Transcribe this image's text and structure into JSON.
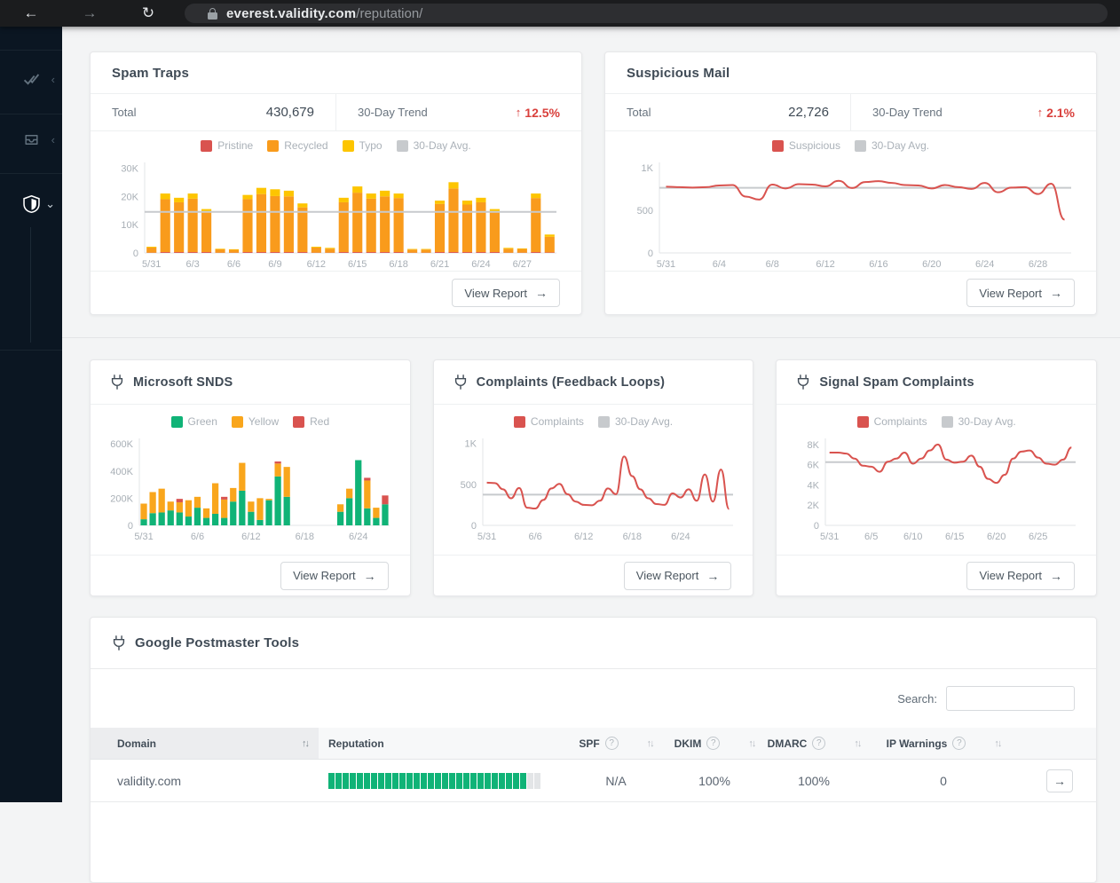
{
  "browser": {
    "url_host": "everest.validity.com",
    "url_path": "/reputation/"
  },
  "icons": {
    "back": "←",
    "forward": "→",
    "refresh": "↻",
    "trend_up": "↑",
    "arrow_right": "→",
    "sort": "↑↓",
    "help": "?",
    "chevron_left": "‹",
    "chevron_down": "⌄"
  },
  "labels": {
    "total": "Total",
    "trend": "30-Day Trend",
    "view_report": "View Report",
    "search": "Search:"
  },
  "sidebar": {
    "items": [
      {
        "name": "verification",
        "icon": "double-check"
      },
      {
        "name": "inbox",
        "icon": "inbox-tray"
      },
      {
        "name": "reputation",
        "icon": "shield",
        "active": true
      }
    ]
  },
  "cards": {
    "spam_traps": {
      "title": "Spam Traps",
      "total": "430,679",
      "trend": "12.5%"
    },
    "suspicious_mail": {
      "title": "Suspicious Mail",
      "total": "22,726",
      "trend": "2.1%"
    },
    "microsoft_snds": {
      "title": "Microsoft SNDS"
    },
    "complaints_fbl": {
      "title": "Complaints (Feedback Loops)"
    },
    "signal_spam": {
      "title": "Signal Spam Complaints"
    },
    "google_postmaster": {
      "title": "Google Postmaster Tools"
    }
  },
  "table": {
    "headers": [
      {
        "label": "Domain",
        "sort": true,
        "help": false
      },
      {
        "label": "Reputation",
        "sort": false,
        "help": false
      },
      {
        "label": "SPF",
        "sort": true,
        "help": true
      },
      {
        "label": "DKIM",
        "sort": true,
        "help": true
      },
      {
        "label": "DMARC",
        "sort": true,
        "help": true
      },
      {
        "label": "IP Warnings",
        "sort": true,
        "help": true
      }
    ],
    "rows": [
      {
        "domain": "validity.com",
        "reputation_segments": 30,
        "reputation_filled": 28,
        "spf": "N/A",
        "dkim": "100%",
        "dmarc": "100%",
        "ip_warnings": "0"
      }
    ]
  },
  "chart_data": [
    {
      "id": "spam-traps",
      "type": "bar",
      "y_unit": "K",
      "ylim": [
        0,
        32
      ],
      "y_ticks": [
        {
          "v": 0,
          "label": "0"
        },
        {
          "v": 10,
          "label": "10K"
        },
        {
          "v": 20,
          "label": "20K"
        },
        {
          "v": 30,
          "label": "30K"
        }
      ],
      "x": [
        "5/31",
        "6/1",
        "6/2",
        "6/3",
        "6/4",
        "6/5",
        "6/6",
        "6/7",
        "6/8",
        "6/9",
        "6/10",
        "6/11",
        "6/12",
        "6/13",
        "6/14",
        "6/15",
        "6/16",
        "6/17",
        "6/18",
        "6/19",
        "6/20",
        "6/21",
        "6/22",
        "6/23",
        "6/24",
        "6/25",
        "6/26",
        "6/27",
        "6/28",
        "6/29"
      ],
      "x_ticks": [
        0,
        3,
        6,
        9,
        12,
        15,
        18,
        21,
        24,
        27
      ],
      "series": [
        {
          "name": "Pristine",
          "color": "#d9534f",
          "values": [
            0.1,
            0.3,
            0.3,
            0.3,
            0.3,
            0.1,
            0.1,
            0.3,
            0.3,
            0.3,
            0.3,
            0.3,
            0.1,
            0.1,
            0.3,
            0.3,
            0.3,
            0.3,
            0.3,
            0.1,
            0.1,
            0.3,
            0.3,
            0.3,
            0.3,
            0.3,
            0.1,
            0.1,
            0.3,
            0.2
          ]
        },
        {
          "name": "Recycled",
          "color": "#f99b1c",
          "values": [
            1.8,
            18.7,
            17.6,
            18.9,
            14.0,
            1.2,
            1.0,
            18.7,
            20.5,
            19.8,
            19.7,
            15.8,
            1.8,
            1.4,
            17.6,
            21.0,
            18.9,
            19.7,
            19.1,
            1.1,
            1.1,
            17.0,
            22.5,
            16.8,
            17.6,
            14.2,
            1.4,
            1.3,
            19.1,
            5.5
          ]
        },
        {
          "name": "Typo",
          "color": "#fdc500",
          "values": [
            0.3,
            2.0,
            1.6,
            1.8,
            1.2,
            0.2,
            0.2,
            1.5,
            2.2,
            2.4,
            2.0,
            1.4,
            0.3,
            0.3,
            1.6,
            2.2,
            1.8,
            2.0,
            1.6,
            0.2,
            0.2,
            1.2,
            2.2,
            1.4,
            1.6,
            1.0,
            0.3,
            0.2,
            1.6,
            0.8
          ]
        }
      ],
      "avg": 14.5,
      "avg_label": "30-Day Avg.",
      "avg_color": "#c7cacd"
    },
    {
      "id": "suspicious-mail",
      "type": "line",
      "ylim": [
        0,
        1060
      ],
      "y_ticks": [
        {
          "v": 0,
          "label": "0"
        },
        {
          "v": 500,
          "label": "500"
        },
        {
          "v": 1000,
          "label": "1K"
        }
      ],
      "x": [
        "5/31",
        "6/1",
        "6/2",
        "6/3",
        "6/4",
        "6/5",
        "6/6",
        "6/7",
        "6/8",
        "6/9",
        "6/10",
        "6/11",
        "6/12",
        "6/13",
        "6/14",
        "6/15",
        "6/16",
        "6/17",
        "6/18",
        "6/19",
        "6/20",
        "6/21",
        "6/22",
        "6/23",
        "6/24",
        "6/25",
        "6/26",
        "6/27",
        "6/28",
        "6/29",
        "6/30"
      ],
      "x_ticks": [
        0,
        4,
        8,
        12,
        16,
        20,
        24,
        28
      ],
      "series": [
        {
          "name": "Suspicious",
          "color": "#d9534f",
          "values": [
            775,
            770,
            765,
            770,
            790,
            795,
            660,
            625,
            800,
            755,
            805,
            800,
            780,
            845,
            760,
            830,
            840,
            820,
            795,
            790,
            755,
            795,
            770,
            750,
            820,
            710,
            765,
            770,
            690,
            810,
            390
          ]
        }
      ],
      "avg": 762,
      "avg_label": "30-Day Avg.",
      "avg_color": "#c7cacd"
    },
    {
      "id": "microsoft-snds",
      "type": "bar",
      "y_unit": "K",
      "ylim": [
        0,
        640
      ],
      "y_ticks": [
        {
          "v": 0,
          "label": "0"
        },
        {
          "v": 200,
          "label": "200K"
        },
        {
          "v": 400,
          "label": "400K"
        },
        {
          "v": 600,
          "label": "600K"
        }
      ],
      "x": [
        "5/31",
        "6/1",
        "6/2",
        "6/3",
        "6/4",
        "6/5",
        "6/6",
        "6/7",
        "6/8",
        "6/9",
        "6/10",
        "6/11",
        "6/12",
        "6/13",
        "6/14",
        "6/15",
        "6/16",
        "6/17",
        "6/18",
        "6/19",
        "6/20",
        "6/21",
        "6/22",
        "6/23",
        "6/24",
        "6/25",
        "6/26",
        "6/27"
      ],
      "x_ticks": [
        0,
        6,
        12,
        18,
        24
      ],
      "series": [
        {
          "name": "Green",
          "color": "#10b377",
          "values": [
            45,
            90,
            95,
            110,
            95,
            65,
            130,
            55,
            85,
            55,
            175,
            255,
            100,
            40,
            185,
            360,
            210,
            0,
            0,
            0,
            0,
            0,
            100,
            200,
            480,
            125,
            55,
            155
          ]
        },
        {
          "name": "Yellow",
          "color": "#f9a61c",
          "values": [
            115,
            155,
            175,
            65,
            75,
            120,
            80,
            70,
            225,
            135,
            100,
            205,
            75,
            160,
            10,
            95,
            220,
            0,
            0,
            0,
            0,
            0,
            55,
            70,
            0,
            205,
            75,
            0
          ]
        },
        {
          "name": "Red",
          "color": "#d9534f",
          "values": [
            0,
            0,
            0,
            0,
            25,
            0,
            0,
            0,
            0,
            20,
            0,
            0,
            0,
            0,
            0,
            15,
            0,
            0,
            0,
            0,
            0,
            0,
            0,
            0,
            0,
            20,
            0,
            65
          ]
        }
      ]
    },
    {
      "id": "complaints-fbl",
      "type": "line",
      "ylim": [
        0,
        1060
      ],
      "y_ticks": [
        {
          "v": 0,
          "label": "0"
        },
        {
          "v": 500,
          "label": "500"
        },
        {
          "v": 1000,
          "label": "1K"
        }
      ],
      "x": [
        "5/31",
        "6/1",
        "6/2",
        "6/3",
        "6/4",
        "6/5",
        "6/6",
        "6/7",
        "6/8",
        "6/9",
        "6/10",
        "6/11",
        "6/12",
        "6/13",
        "6/14",
        "6/15",
        "6/16",
        "6/17",
        "6/18",
        "6/19",
        "6/20",
        "6/21",
        "6/22",
        "6/23",
        "6/24",
        "6/25",
        "6/26",
        "6/27",
        "6/28",
        "6/29",
        "6/30"
      ],
      "x_ticks": [
        0,
        6,
        12,
        18,
        24
      ],
      "series": [
        {
          "name": "Complaints",
          "color": "#d9534f",
          "values": [
            520,
            515,
            440,
            330,
            455,
            215,
            205,
            310,
            450,
            505,
            380,
            290,
            250,
            245,
            300,
            450,
            380,
            840,
            600,
            440,
            330,
            260,
            250,
            390,
            340,
            440,
            300,
            620,
            290,
            680,
            200
          ]
        }
      ],
      "avg": 375,
      "avg_label": "30-Day Avg.",
      "avg_color": "#c7cacd"
    },
    {
      "id": "signal-spam",
      "type": "line",
      "y_unit": "K",
      "ylim": [
        0,
        8.6
      ],
      "y_ticks": [
        {
          "v": 0,
          "label": "0"
        },
        {
          "v": 2,
          "label": "2K"
        },
        {
          "v": 4,
          "label": "4K"
        },
        {
          "v": 6,
          "label": "6K"
        },
        {
          "v": 8,
          "label": "8K"
        }
      ],
      "x": [
        "5/31",
        "6/1",
        "6/2",
        "6/3",
        "6/4",
        "6/5",
        "6/6",
        "6/7",
        "6/8",
        "6/9",
        "6/10",
        "6/11",
        "6/12",
        "6/13",
        "6/14",
        "6/15",
        "6/16",
        "6/17",
        "6/18",
        "6/19",
        "6/20",
        "6/21",
        "6/22",
        "6/23",
        "6/24",
        "6/25",
        "6/26",
        "6/27",
        "6/28",
        "6/29"
      ],
      "x_ticks": [
        0,
        5,
        10,
        15,
        20,
        25
      ],
      "series": [
        {
          "name": "Complaints",
          "color": "#d9534f",
          "values": [
            7.2,
            7.2,
            7.1,
            6.6,
            5.9,
            5.8,
            5.3,
            6.3,
            6.6,
            7.2,
            6.1,
            6.6,
            7.4,
            8.0,
            6.5,
            6.2,
            6.3,
            6.9,
            5.8,
            4.6,
            4.2,
            5.0,
            6.6,
            7.3,
            7.4,
            6.7,
            6.1,
            6.0,
            6.5,
            7.7
          ]
        }
      ],
      "avg": 6.25,
      "avg_label": "30-Day Avg.",
      "avg_color": "#c7cacd"
    }
  ]
}
